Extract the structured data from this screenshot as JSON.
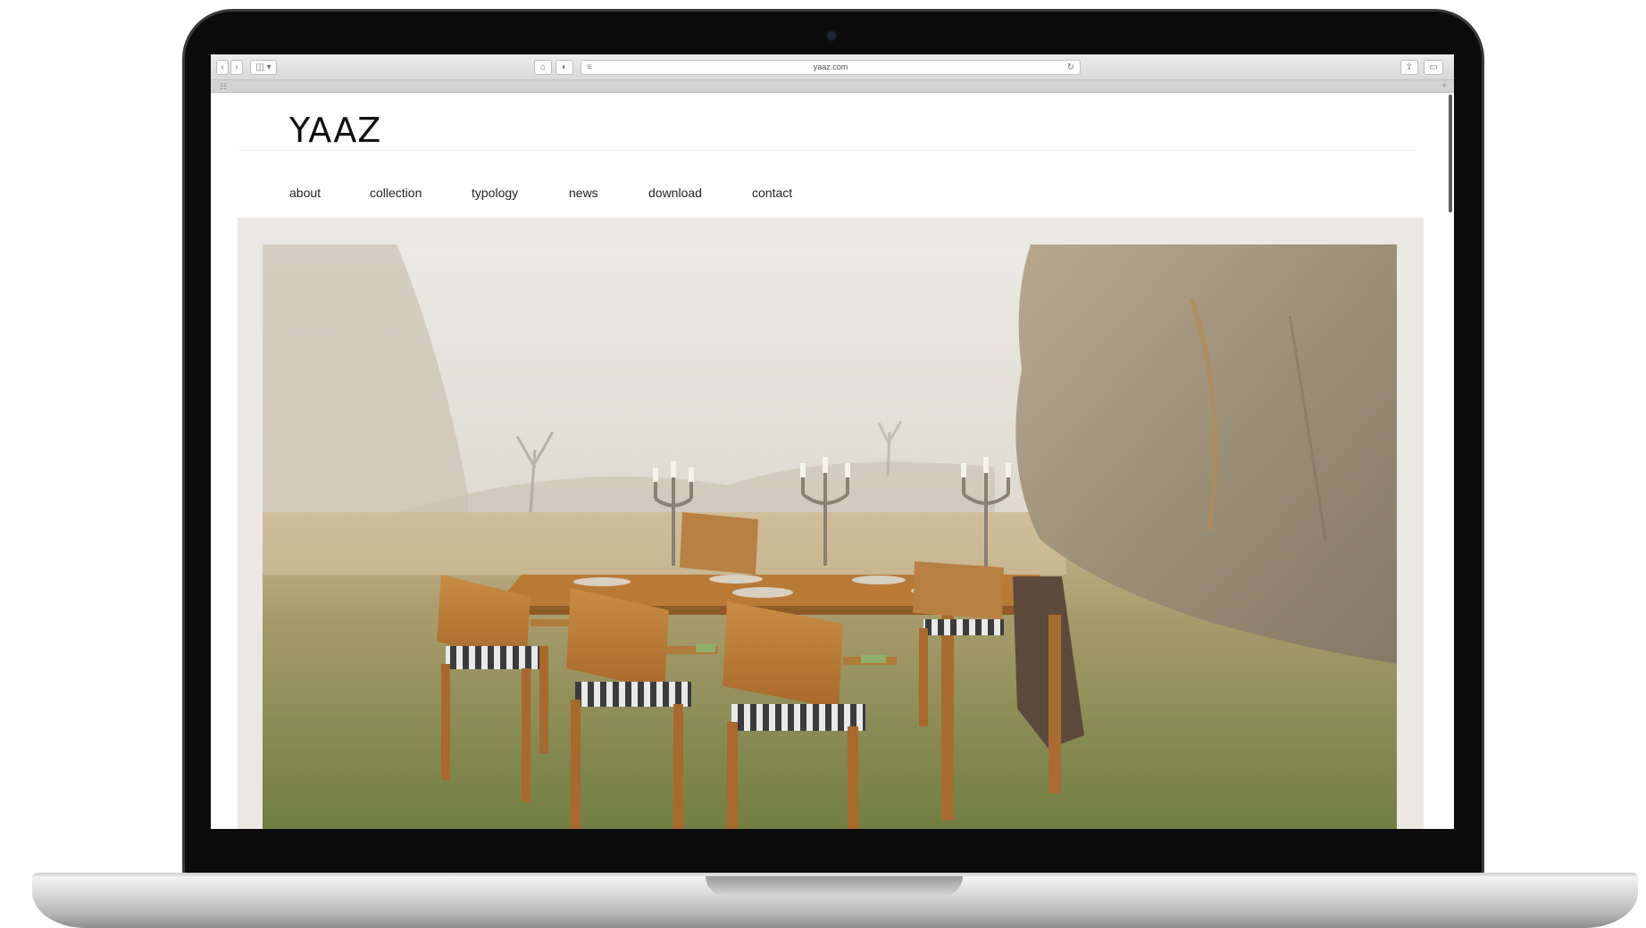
{
  "browser": {
    "url": "yaaz.com",
    "nav_back_icon": "chevron-left-icon",
    "nav_forward_icon": "chevron-right-icon",
    "sidebar_icon": "sidebar-icon",
    "home_icon": "home-icon",
    "privacy_icon": "shield-icon",
    "reader_icon": "reader-icon",
    "reload_icon": "reload-icon",
    "share_icon": "share-icon",
    "tabs_icon": "tabs-icon"
  },
  "site": {
    "logo": "YAAZ",
    "nav": [
      {
        "label": "about"
      },
      {
        "label": "collection"
      },
      {
        "label": "typology"
      },
      {
        "label": "news"
      },
      {
        "label": "download"
      },
      {
        "label": "contact"
      }
    ]
  },
  "colors": {
    "laptop_bezel": "#0b0b0b",
    "page_background": "#ffffff",
    "hero_frame": "#ebe7e2",
    "text": "#222222"
  }
}
